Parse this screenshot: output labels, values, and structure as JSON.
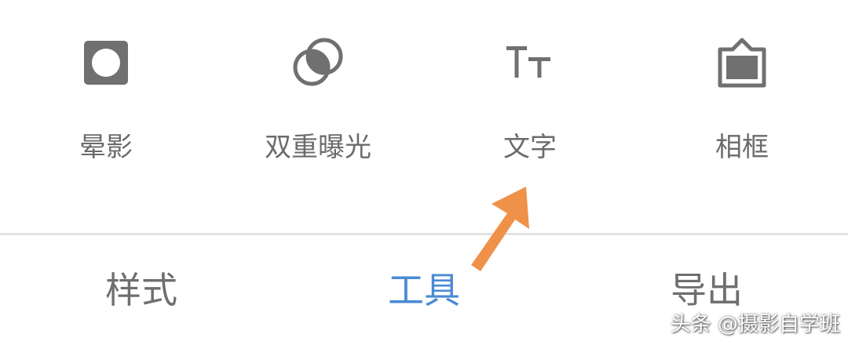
{
  "tools": [
    {
      "label": "晕影",
      "icon": "vignette-icon"
    },
    {
      "label": "双重曝光",
      "icon": "double-exposure-icon"
    },
    {
      "label": "文字",
      "icon": "text-icon"
    },
    {
      "label": "相框",
      "icon": "frame-icon"
    }
  ],
  "tabs": [
    {
      "label": "样式",
      "active": false
    },
    {
      "label": "工具",
      "active": true
    },
    {
      "label": "导出",
      "active": false
    }
  ],
  "annotation": {
    "icon": "arrow-icon",
    "color": "#f0914a"
  },
  "watermark": {
    "text": "头条 @摄影自学班"
  },
  "colors": {
    "icon": "#707070",
    "label": "#6b6b6b",
    "tab_active": "#4a8ad4",
    "tab_inactive": "#6f6f6f",
    "divider": "#e2e2e2"
  }
}
